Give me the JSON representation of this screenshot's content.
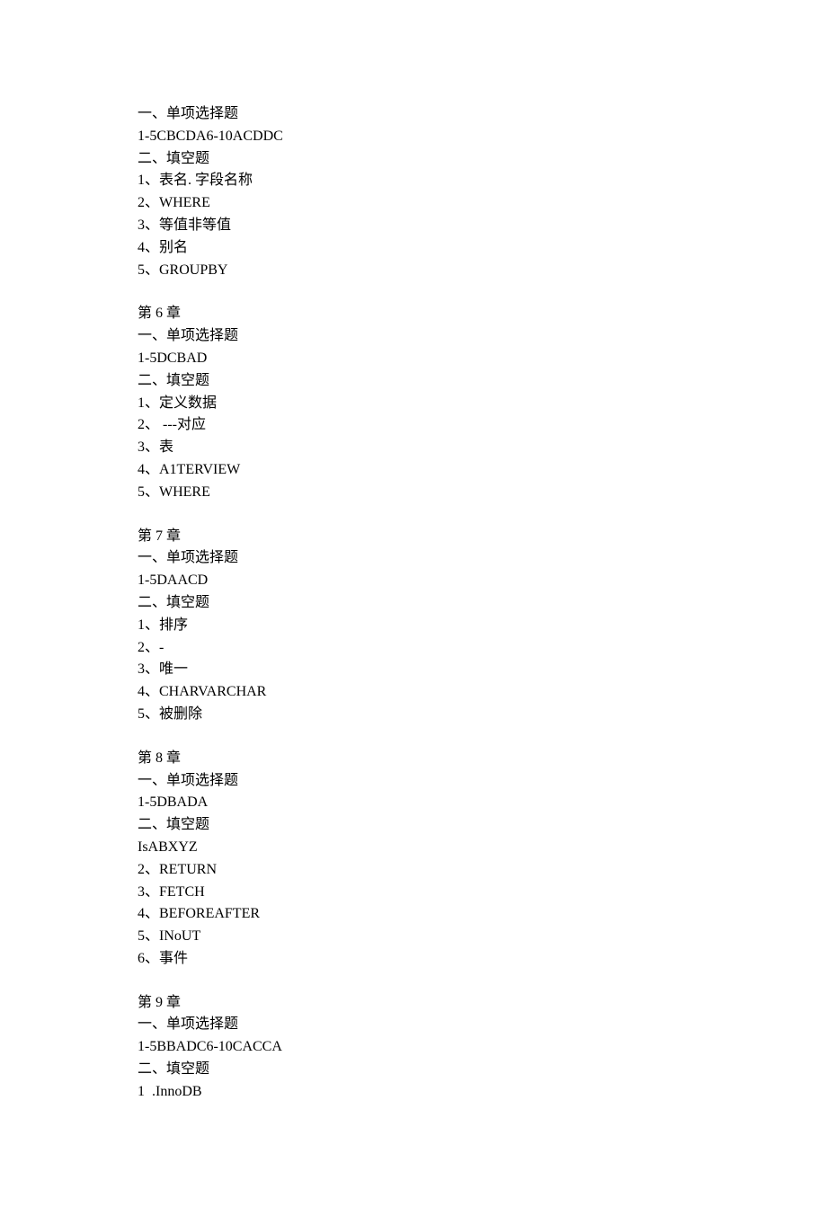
{
  "lines": [
    "一、单项选择题",
    "1-5CBCDA6-10ACDDC",
    "二、填空题",
    "1、表名. 字段名称",
    "2、WHERE",
    "3、等值非等值",
    "4、别名",
    "5、GROUPBY",
    "",
    "第 6 章",
    "一、单项选择题",
    "1-5DCBAD",
    "二、填空题",
    "1、定义数据",
    "2、 ---对应",
    "3、表",
    "4、A1TERVIEW",
    "5、WHERE",
    "",
    "第 7 章",
    "一、单项选择题",
    "1-5DAACD",
    "二、填空题",
    "1、排序",
    "2、-",
    "3、唯一",
    "4、CHARVARCHAR",
    "5、被删除",
    "",
    "第 8 章",
    "一、单项选择题",
    "1-5DBADA",
    "二、填空题",
    "IsABXYZ",
    "2、RETURN",
    "3、FETCH",
    "4、BEFOREAFTER",
    "5、INoUT",
    "6、事件",
    "",
    "第 9 章",
    "一、单项选择题",
    "1-5BBADC6-10CACCA",
    "二、填空题",
    "1  .InnoDB"
  ]
}
